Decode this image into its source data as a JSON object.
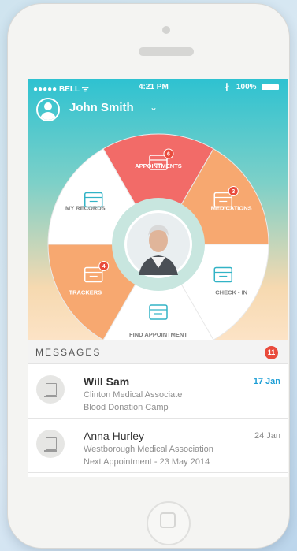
{
  "status_bar": {
    "carrier": "●●●●● BELL ᯤ",
    "time": "4:21 PM",
    "battery": "100%"
  },
  "user": {
    "name": "John Smith"
  },
  "wheel": {
    "segments": [
      {
        "id": "appointments",
        "label": "APPOINTMENTS",
        "badge": "6",
        "color": "#f26b68",
        "icon": "calendar-icon"
      },
      {
        "id": "medications",
        "label": "MEDICATIONS",
        "badge": "3",
        "color": "#f7a870",
        "icon": "medicine-icon"
      },
      {
        "id": "check-in",
        "label": "CHECK - IN",
        "badge": "",
        "color": "#ffffff",
        "icon": "ticket-icon"
      },
      {
        "id": "find-appointment",
        "label": "FIND APPOINTMENT",
        "badge": "",
        "color": "#ffffff",
        "icon": "calendar-search-icon"
      },
      {
        "id": "trackers",
        "label": "TRACKERS",
        "badge": "4",
        "color": "#f7a870",
        "icon": "chart-icon"
      },
      {
        "id": "my-records",
        "label": "MY RECORDS",
        "badge": "",
        "color": "#ffffff",
        "icon": "building-icon"
      }
    ],
    "icon_color": "#32b3c6",
    "ring_color": "#c8e6df"
  },
  "messages": {
    "title": "MESSAGES",
    "count": "11",
    "items": [
      {
        "name": "Will Sam",
        "org": "Clinton Medical Associate",
        "subject": "Blood Donation Camp",
        "date": "17 Jan",
        "unread": true
      },
      {
        "name": "Anna Hurley",
        "org": "Westborough Medical Association",
        "subject": "Next Appointment - 23 May 2014",
        "date": "24 Jan",
        "unread": false
      }
    ]
  }
}
